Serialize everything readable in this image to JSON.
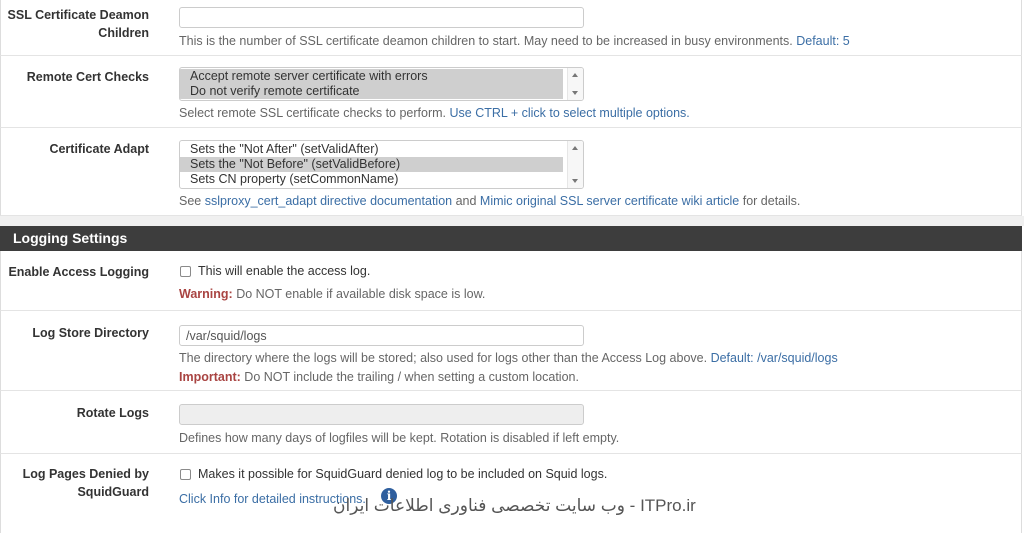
{
  "ssl_children": {
    "label": "SSL Certificate Deamon Children",
    "label_line1": "SSL Certificate Deamon",
    "label_line2": "Children",
    "value": "",
    "help": "This is the number of SSL certificate deamon children to start. May need to be increased in busy environments.",
    "default_text": "Default: 5"
  },
  "remote_cert": {
    "label": "Remote Cert Checks",
    "options": [
      {
        "label": "Accept remote server certificate with errors",
        "selected": true
      },
      {
        "label": "Do not verify remote certificate",
        "selected": true
      }
    ],
    "help": "Select remote SSL certificate checks to perform.",
    "help_link": "Use CTRL + click to select multiple options."
  },
  "cert_adapt": {
    "label": "Certificate Adapt",
    "options": [
      {
        "label": "Sets the \"Not After\" (setValidAfter)",
        "selected": false
      },
      {
        "label": "Sets the \"Not Before\" (setValidBefore)",
        "selected": true
      },
      {
        "label": "Sets CN property (setCommonName)",
        "selected": false
      }
    ],
    "help_prefix": "See",
    "help_link1": "sslproxy_cert_adapt directive documentation",
    "help_mid": "and",
    "help_link2": "Mimic original SSL server certificate wiki article",
    "help_suffix": "for details."
  },
  "logging": {
    "section_title": "Logging Settings",
    "access_log": {
      "label": "Enable Access Logging",
      "checkbox_text": "This will enable the access log.",
      "checked": false,
      "warning_label": "Warning:",
      "warning_text": "Do NOT enable if available disk space is low."
    },
    "store_dir": {
      "label": "Log Store Directory",
      "value": "/var/squid/logs",
      "help": "The directory where the logs will be stored; also used for logs other than the Access Log above.",
      "default_text": "Default: /var/squid/logs",
      "important_label": "Important:",
      "important_text": "Do NOT include the trailing / when setting a custom location."
    },
    "rotate": {
      "label": "Rotate Logs",
      "value": "",
      "help": "Defines how many days of logfiles will be kept. Rotation is disabled if left empty."
    },
    "squidguard": {
      "label_line1": "Log Pages Denied by",
      "label_line2": "SquidGuard",
      "checkbox_text": "Makes it possible for SquidGuard denied log to be included on Squid logs.",
      "checked": false,
      "help": "Click Info for detailed instructions."
    }
  },
  "watermark": {
    "text": "ITPro.ir - وب سایت تخصصی فناوری اطلاعات ایران",
    "icon": "info-icon"
  }
}
